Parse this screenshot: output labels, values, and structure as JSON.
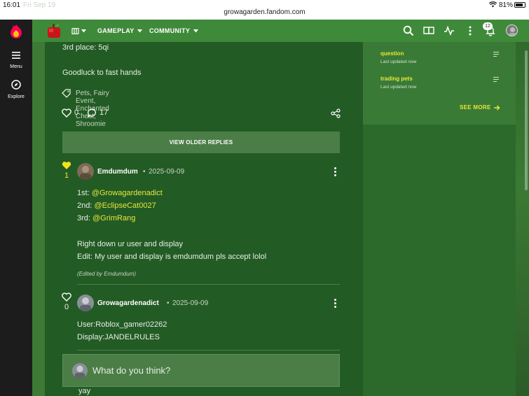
{
  "status_bar": {
    "time": "16:01",
    "date": "Fri Sep 19",
    "url": "growagarden.fandom.com",
    "battery": "81%"
  },
  "rail": {
    "menu_label": "Menu",
    "explore_label": "Explore"
  },
  "topbar": {
    "nav_gameplay": "GAMEPLAY",
    "nav_community": "COMMUNITY",
    "notifications_count": "12"
  },
  "post": {
    "line_third_place": "3rd place: 5qi",
    "line_goodluck": "Goodluck to fast hands",
    "tags": "Pets, Fairy Event, Enchanted Chest, Shroomie",
    "likes": "0",
    "comments": "17"
  },
  "older_replies_label": "VIEW OLDER REPLIES",
  "replies": [
    {
      "user": "Emdumdum",
      "date": "2025-09-09",
      "likes": "1",
      "body": {
        "l1_prefix": "1st: ",
        "l1_mention": "@Growagardenadict",
        "l2_prefix": "2nd: ",
        "l2_mention": "@EclipseCat0027",
        "l3_prefix": "3rd: ",
        "l3_mention": "@GrimRang",
        "l4": "Right down ur user and display",
        "l5": "Edit: My user and display is emdumdum pls accept lolol"
      },
      "edited": "(Edited by Emdumdum)"
    },
    {
      "user": "Growagardenadict",
      "date": "2025-09-09",
      "likes": "0",
      "body": {
        "l1": "User:Roblox_gamer02262",
        "l2": "Display:JANDELRULES"
      }
    }
  ],
  "reply_box_placeholder": "What do you think?",
  "partial_next_reply": "yay",
  "right_rail": {
    "items": [
      {
        "title": "question",
        "subtitle": "Last updated now"
      },
      {
        "title": "trading pets",
        "subtitle": "Last updated now"
      }
    ],
    "see_more": "SEE MORE"
  },
  "colors": {
    "accent_yellow": "#e6e83a",
    "topbar_green": "#3f8a3a",
    "content_green": "#235b25"
  }
}
